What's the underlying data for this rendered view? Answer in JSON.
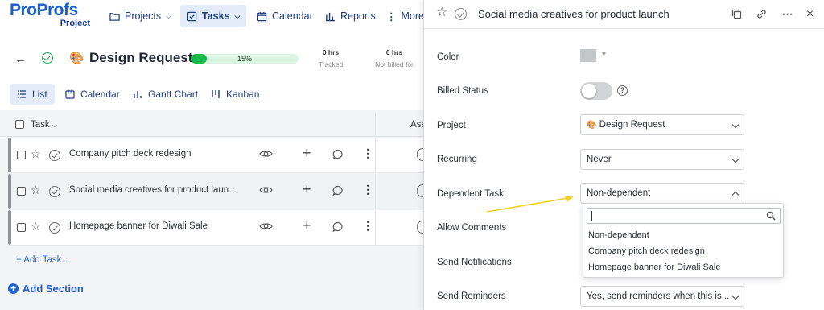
{
  "logo": {
    "brand": "ProProfs",
    "product": "Project"
  },
  "nav": {
    "projects": "Projects",
    "tasks": "Tasks",
    "calendar": "Calendar",
    "reports": "Reports",
    "more": "More"
  },
  "project": {
    "title": "Design Request",
    "emoji": "🎨",
    "progress_percent": 15,
    "progress_label": "15%",
    "tracked_value": "0 hrs",
    "tracked_label": "Tracked",
    "not_billed_value": "0 hrs",
    "not_billed_label": "Not billed for"
  },
  "views": [
    "List",
    "Calendar",
    "Gantt Chart",
    "Kanban"
  ],
  "table": {
    "task_header": "Task",
    "assignee_header": "Ass",
    "rows": [
      {
        "name": "Company pitch deck redesign"
      },
      {
        "name": "Social media creatives for product laun..."
      },
      {
        "name": "Homepage banner for Diwali Sale"
      }
    ],
    "add_task": "+ Add Task...",
    "add_section": "Add Section"
  },
  "panel": {
    "title": "Social media creatives for product launch",
    "fields": {
      "color": "Color",
      "billed_status": "Billed Status",
      "project": "Project",
      "recurring": "Recurring",
      "dependent_task": "Dependent Task",
      "allow_comments": "Allow Comments",
      "send_notifications": "Send Notifications",
      "send_reminders": "Send Reminders"
    },
    "values": {
      "color_hex": "#c4c6ca",
      "billed_on": false,
      "project_emoji": "🎨",
      "project": "Design Request",
      "recurring": "Never",
      "dependent_task": "Non-dependent",
      "send_reminders": "Yes, send reminders when this is..."
    },
    "dropdown_options": [
      "Non-dependent",
      "Company pitch deck redesign",
      "Homepage banner for Diwali Sale"
    ]
  },
  "colors": {
    "brand": "#1c5fd1",
    "progress": "#19b84b",
    "annotation_arrow": "#f0d020"
  }
}
